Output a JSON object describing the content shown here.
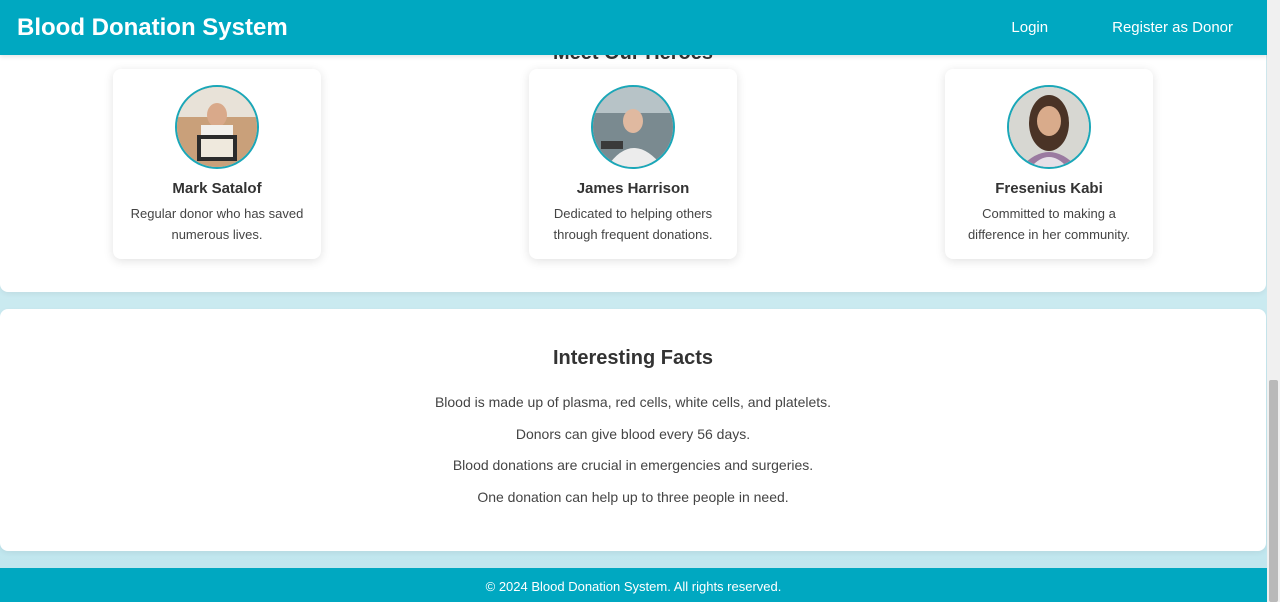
{
  "navbar": {
    "brand": "Blood Donation System",
    "links": [
      "Login",
      "Register as Donor"
    ]
  },
  "heroes": {
    "title": "Meet Our Heroes",
    "items": [
      {
        "name": "Mark Satalof",
        "description": "Regular donor who has saved numerous lives.",
        "avatar_icon": "donor-photo-icon"
      },
      {
        "name": "James Harrison",
        "description": "Dedicated to helping others through frequent donations.",
        "avatar_icon": "donor-photo-icon"
      },
      {
        "name": "Fresenius Kabi",
        "description": "Committed to making a difference in her community.",
        "avatar_icon": "donor-photo-icon"
      }
    ]
  },
  "facts": {
    "title": "Interesting Facts",
    "items": [
      "Blood is made up of plasma, red cells, white cells, and platelets.",
      "Donors can give blood every 56 days.",
      "Blood donations are crucial in emergencies and surgeries.",
      "One donation can help up to three people in need."
    ]
  },
  "footer": {
    "text": "© 2024 Blood Donation System. All rights reserved."
  },
  "colors": {
    "primary": "#00a8c1",
    "avatar_border": "#1aa7b8",
    "background": "#cdebf1"
  }
}
